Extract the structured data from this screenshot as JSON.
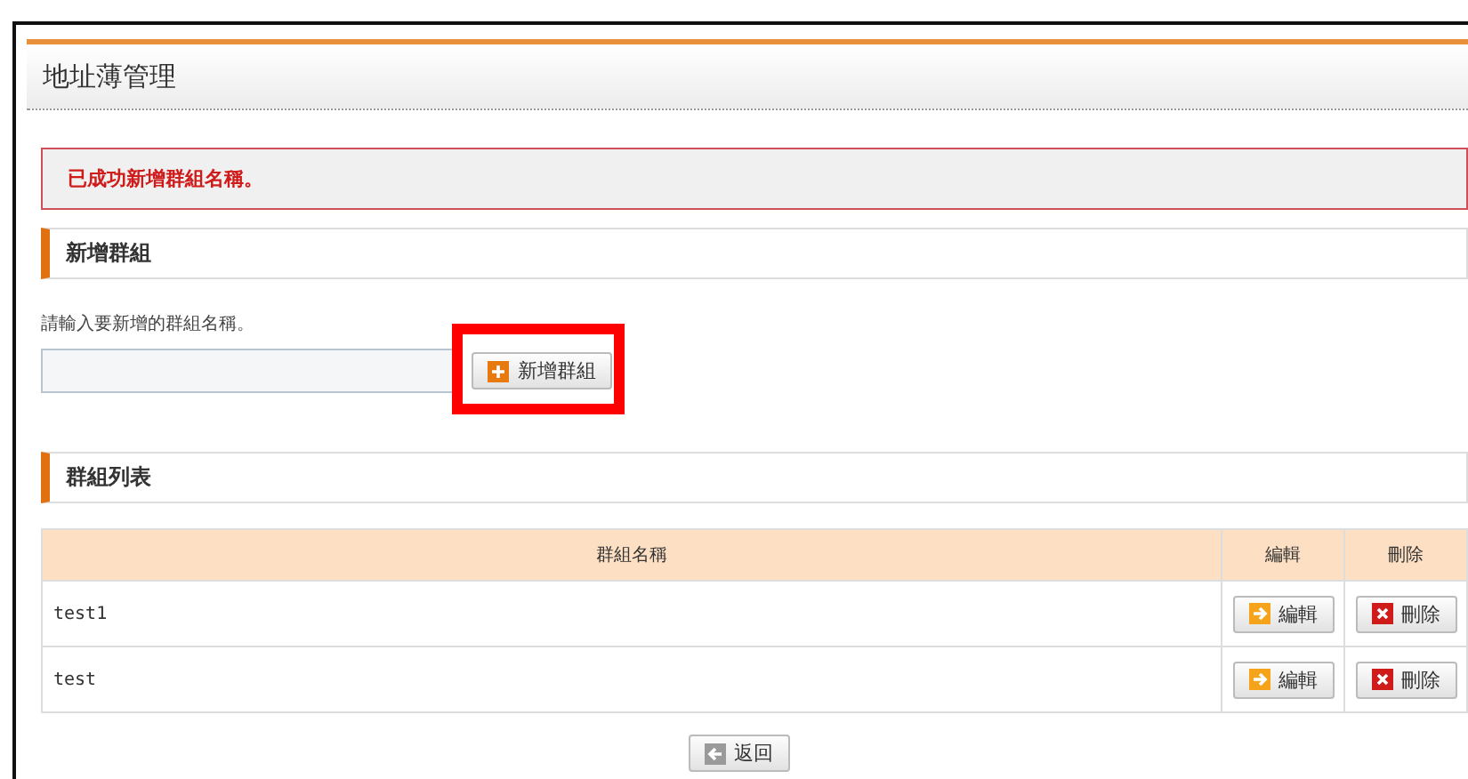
{
  "page": {
    "title": "地址薄管理"
  },
  "message": {
    "text": "已成功新增群組名稱。"
  },
  "add_section": {
    "heading": "新增群組",
    "instruction": "請輸入要新增的群組名稱。",
    "button": {
      "label": "新增群組",
      "highlighted": true
    }
  },
  "list_section": {
    "heading": "群組列表"
  },
  "table": {
    "columns": [
      "群組名稱",
      "編輯",
      "刪除"
    ],
    "rows": [
      {
        "name": "test1",
        "edit": "編輯",
        "delete": "刪除"
      },
      {
        "name": "test",
        "edit": "編輯",
        "delete": "刪除"
      }
    ]
  },
  "back_button": {
    "label": "返回"
  }
}
